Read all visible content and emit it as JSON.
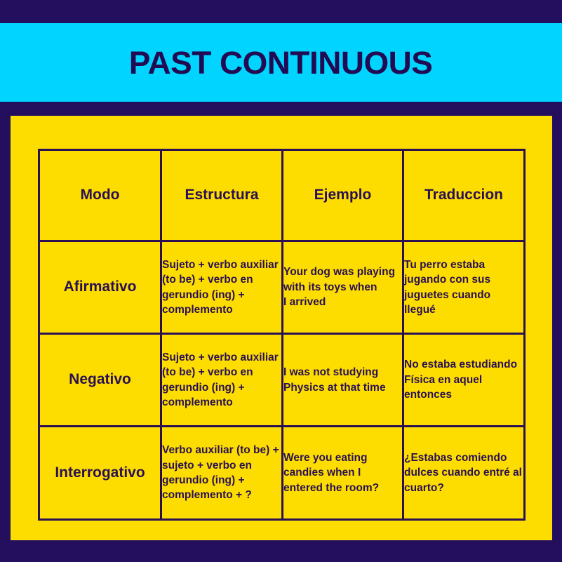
{
  "banner": {
    "title": "PAST CONTINUOUS",
    "background_color": "#00D4FF",
    "text_color": "#220B52"
  },
  "page": {
    "background_color": "#240E5E",
    "card_color": "#FDDD00",
    "border_color": "#2A1052"
  },
  "table": {
    "headers": [
      "Modo",
      "Estructura",
      "Ejemplo",
      "Traduccion"
    ],
    "rows": [
      {
        "modo": "Afirmativo",
        "estructura": "Sujeto + verbo auxiliar (to be) + verbo en gerundio (ing) + complemento",
        "ejemplo": "Your dog was playing with its toys when\nI arrived",
        "traduccion": "Tu perro estaba jugando con sus juguetes cuando llegué"
      },
      {
        "modo": "Negativo",
        "estructura": "Sujeto + verbo auxiliar (to be) + verbo en gerundio (ing) + complemento",
        "ejemplo": "I was not studying\nPhysics at that time",
        "traduccion": "No estaba estudiando Física en aquel entonces"
      },
      {
        "modo": "Interrogativo",
        "estructura": "Verbo auxiliar (to be) + sujeto + verbo en gerundio (ing) + complemento + ?",
        "ejemplo": "Were you eating candies when I entered the room?",
        "traduccion": "¿Estabas comiendo dulces cuando entré al cuarto?"
      }
    ]
  }
}
